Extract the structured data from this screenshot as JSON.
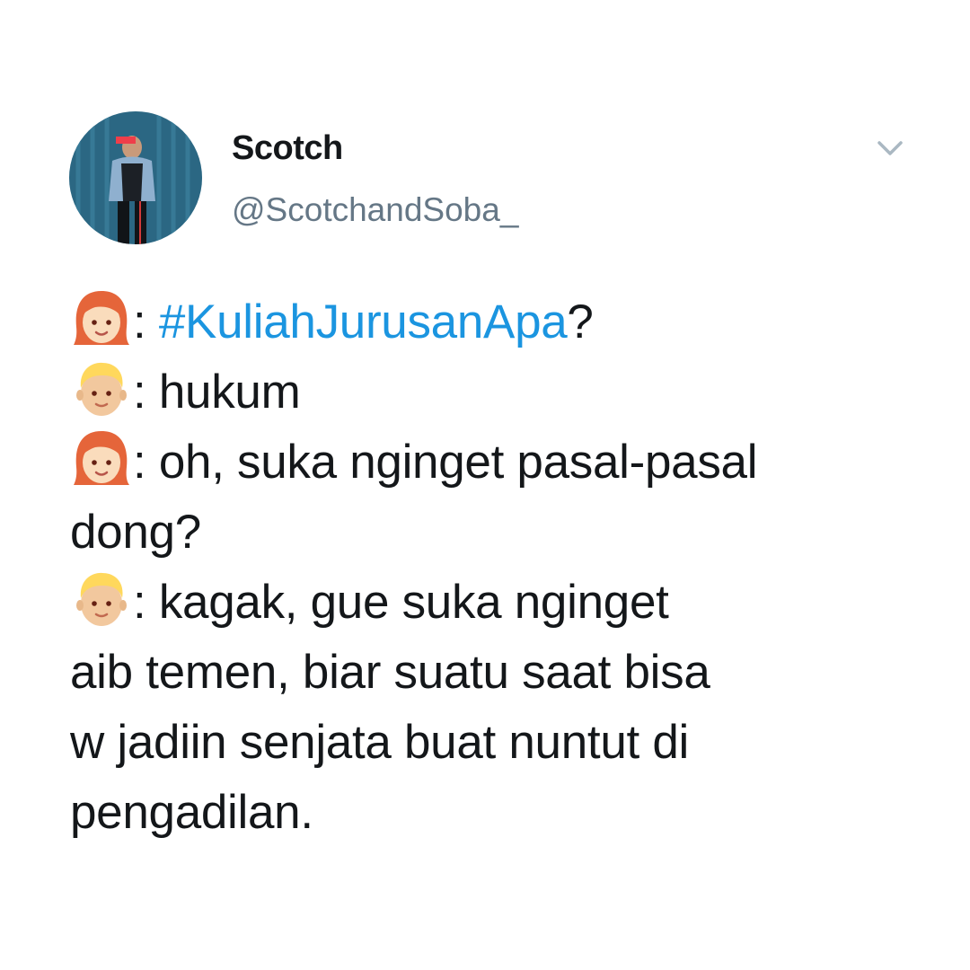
{
  "author": {
    "display_name": "Scotch",
    "handle": "@ScotchandSoba_",
    "avatar_icon": "profile-avatar-photo"
  },
  "menu": {
    "icon": "chevron-down-icon"
  },
  "tweet": {
    "line1": {
      "speaker": "woman-red-hair-emoji",
      "sep": ": ",
      "hashtag": "#KuliahJurusanApa",
      "after": "?"
    },
    "line2": {
      "speaker": "man-blond-emoji",
      "text": ": hukum"
    },
    "line3": {
      "speaker": "woman-red-hair-emoji",
      "text": ": oh, suka nginget pasal-pasal"
    },
    "line4": {
      "text": "dong?"
    },
    "line5": {
      "speaker": "man-blond-emoji",
      "text": ": kagak, gue suka nginget"
    },
    "line6": {
      "text": "aib temen, biar suatu saat bisa"
    },
    "line7": {
      "text": "w jadiin senjata buat nuntut di"
    },
    "line8": {
      "text": "pengadilan."
    }
  },
  "colors": {
    "hashtag": "#1b95e0",
    "handle": "#657786",
    "text": "#14171a"
  }
}
